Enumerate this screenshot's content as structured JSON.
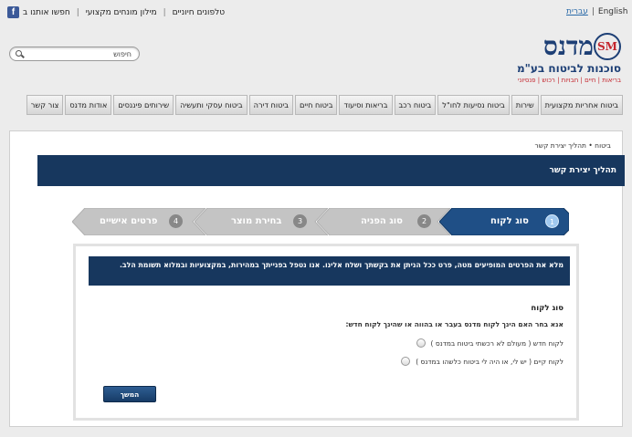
{
  "header": {
    "lang_english": "English",
    "lang_hebrew": "עברית",
    "top_links": [
      "טלפונים חיוניים",
      "מילון מונחים מקצועי",
      "חפשו אותנו ב"
    ],
    "logo": {
      "brand": "מדנס",
      "badge": "SM",
      "tagline": "סוכנות לביטוח בע\"מ",
      "subline": "בריאות | חיים | חבויות | רכוש | פנסיוני"
    },
    "search": {
      "placeholder": "חיפוש",
      "value": ""
    }
  },
  "nav": [
    "ביטוח אחריות מקצועית",
    "שירות",
    "ביטוח נסיעות לחו\"ל",
    "ביטוח רכב",
    "בריאות וסיעוד",
    "ביטוח חיים",
    "ביטוח דירה",
    "ביטוח עסקי ותעשיה",
    "שירותים פיננסים",
    "אודות מדנס",
    "צור קשר"
  ],
  "breadcrumb": {
    "home": "ביטוח",
    "sep": "•",
    "current": "תהליך יצירת קשר"
  },
  "page_title": "תהליך יצירת קשר",
  "steps": [
    {
      "num": "1",
      "label": "סוג לקוח",
      "state": "active"
    },
    {
      "num": "2",
      "label": "סוג הפניה",
      "state": "inactive"
    },
    {
      "num": "3",
      "label": "בחירת מוצר",
      "state": "inactive"
    },
    {
      "num": "4",
      "label": "פרטים אישיים",
      "state": "inactive"
    }
  ],
  "form": {
    "notice": "מלא את הפרטים המופיעים מטה, פרט ככל הניתן את בקשתך ושלח אלינו. אנו נטפל בפנייתך במהירות, במקצועיות ובמלוא תשומת הלב.",
    "section_title": "סוג לקוח",
    "question": "אנא בחר האם הינך לקוח מדנס בעבר או בהווה או שהינך לקוח חדש:",
    "options": [
      "לקוח חדש ( מעולם לא רכשתי ביטוח במדנס )",
      "לקוח קיים ( יש לי, או היה לי ביטוח כלשהו במדנס )"
    ],
    "next_button": "המשך"
  },
  "colors": {
    "navy": "#17375e",
    "step_active": "#1f4f86",
    "step_inactive": "#c4c4c4"
  }
}
